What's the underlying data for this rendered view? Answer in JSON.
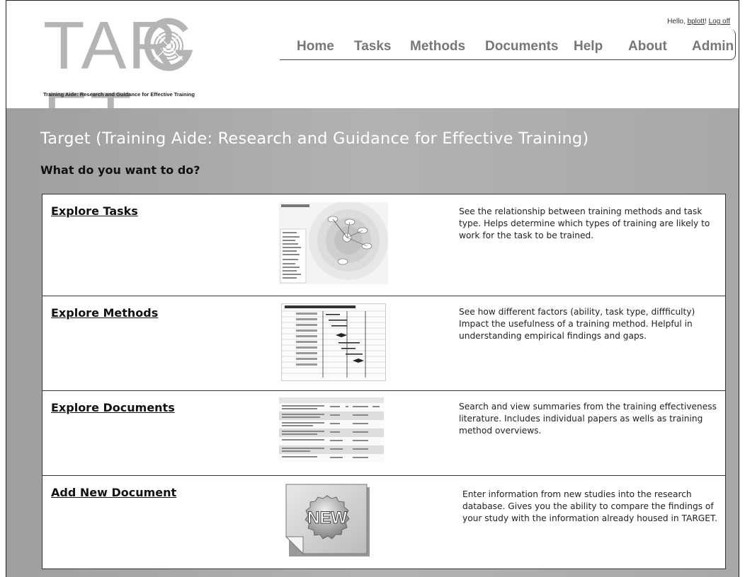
{
  "logo": {
    "text": "TARGET",
    "tagline": "Training Aide: Research and Guidance for Effective Training"
  },
  "user": {
    "greeting": "Hello, ",
    "username": "bplott",
    "separator": "! ",
    "logoff": "Log off"
  },
  "nav": {
    "items": [
      {
        "label": "Home"
      },
      {
        "label": "Tasks"
      },
      {
        "label": "Methods"
      },
      {
        "label": "Documents"
      },
      {
        "label": "Help"
      },
      {
        "label": "About"
      },
      {
        "label": "Admin"
      }
    ]
  },
  "main": {
    "title": "Target (Training Aide: Research and Guidance for Effective Training)",
    "prompt": "What do you want to do?",
    "options": [
      {
        "title": "Explore Tasks",
        "description": "See the relationship between training methods and task type. Helps determine which types of training are likely to work for the task to be trained.",
        "thumbnail": "task-network-diagram-thumbnail"
      },
      {
        "title": "Explore Methods",
        "description": "See how different factors (ability, task type, diffficulty) Impact the usefulness of a training method. Helpful in understanding empirical findings and gaps.",
        "thumbnail": "forest-plot-thumbnail"
      },
      {
        "title": "Explore Documents",
        "description": "Search and view summaries from the training effectiveness literature. Includes individual papers as wells as training method overviews.",
        "thumbnail": "document-table-thumbnail"
      },
      {
        "title": "Add New Document",
        "description": "Enter information from new studies into the research database. Gives you the ability to compare the findings of your study with the information already housed in TARGET.",
        "thumbnail": "new-badge-icon",
        "badge_text": "NEW"
      }
    ]
  },
  "colors": {
    "logo_gray": "#b4b4b4",
    "nav_text": "#777777",
    "main_bg": "#a8a8a8",
    "title_text": "#ffffff"
  }
}
